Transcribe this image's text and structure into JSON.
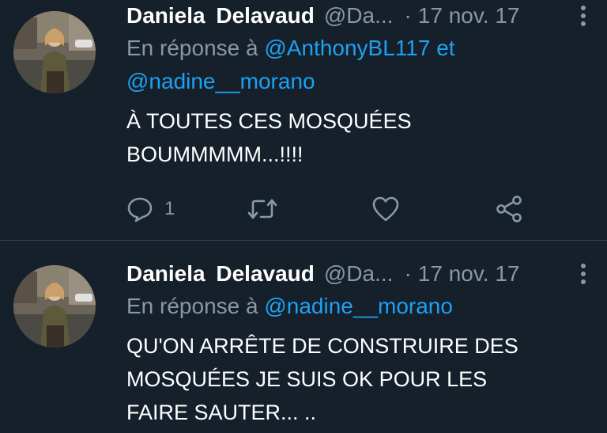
{
  "tweets": [
    {
      "display_name": "Daniela  Delavaud",
      "handle": "@Da...",
      "separator": "·",
      "date": "17 nov. 17",
      "reply_prefix": "En réponse à",
      "reply_mentions": [
        "@AnthonyBL117",
        "@nadine__morano"
      ],
      "reply_joiner": "et",
      "body_lines": [
        "À TOUTES CES MOSQUÉES",
        "BOUMMMMM...!!!!"
      ],
      "actions": {
        "reply_count": "1",
        "reply_icon": "reply-icon",
        "retweet_icon": "retweet-icon",
        "like_icon": "heart-icon",
        "share_icon": "share-icon"
      }
    },
    {
      "display_name": "Daniela  Delavaud",
      "handle": "@Da...",
      "separator": "·",
      "date": "17 nov. 17",
      "reply_prefix": "En réponse à",
      "reply_mentions": [
        "@nadine__morano"
      ],
      "body_lines": [
        "QU'ON ARRÊTE DE CONSTRUIRE DES",
        "MOSQUÉES JE SUIS  OK POUR LES",
        "FAIRE SAUTER... .."
      ]
    }
  ],
  "colors": {
    "background": "#15202b",
    "divider": "#38444d",
    "text_primary": "#ffffff",
    "text_secondary": "#8899a6",
    "mention": "#1da1f2"
  }
}
